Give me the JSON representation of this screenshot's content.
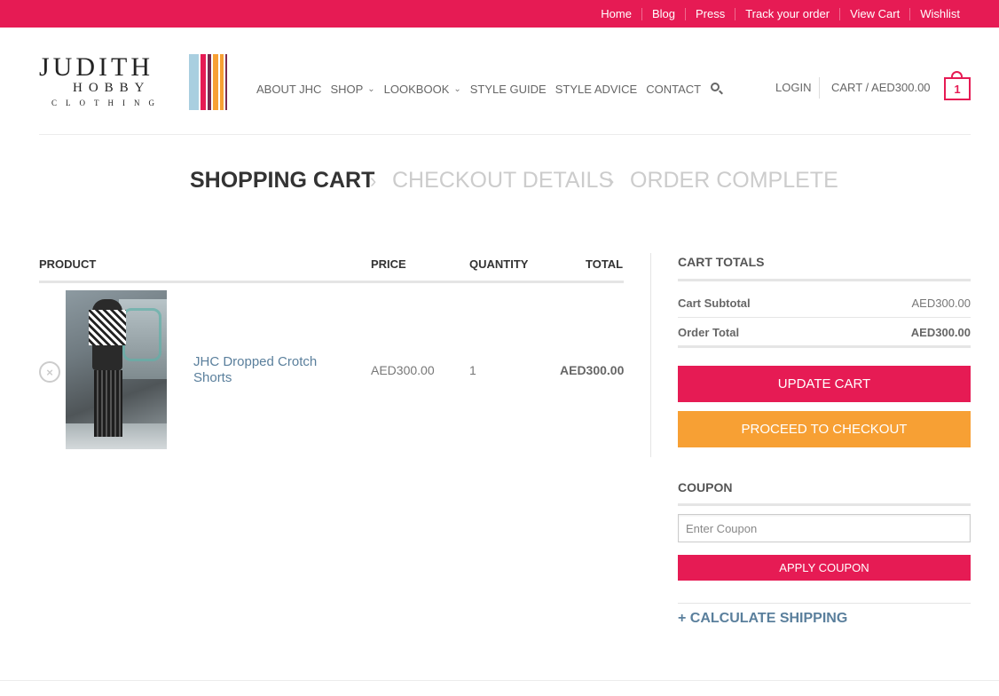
{
  "topbar": {
    "links": [
      "Home",
      "Blog",
      "Press",
      "Track your order",
      "View Cart",
      "Wishlist"
    ],
    "color": "#e61b54"
  },
  "logo": {
    "line1": "JUDITH",
    "line2": "HOBBY",
    "line3": "CLOTHING",
    "stripe_colors": [
      "#a9cfe0",
      "#e61b54",
      "#7a2a4f",
      "#f7a034",
      "#f7a034",
      "#7a2a4f"
    ]
  },
  "nav": {
    "items": [
      {
        "label": "ABOUT JHC",
        "has_dropdown": false
      },
      {
        "label": "SHOP",
        "has_dropdown": true
      },
      {
        "label": "LOOKBOOK",
        "has_dropdown": true
      },
      {
        "label": "STYLE GUIDE",
        "has_dropdown": false
      },
      {
        "label": "STYLE ADVICE",
        "has_dropdown": false
      },
      {
        "label": "CONTACT",
        "has_dropdown": false
      }
    ],
    "search_icon": "search-icon",
    "login": "LOGIN",
    "cart": "CART / AED300.00",
    "cart_count": "1"
  },
  "steps": {
    "active": "SHOPPING CART",
    "step2": "CHECKOUT DETAILS",
    "step3": "ORDER COMPLETE",
    "separator": "›"
  },
  "cart_table": {
    "headers": {
      "product": "PRODUCT",
      "price": "PRICE",
      "quantity": "QUANTITY",
      "total": "TOTAL"
    },
    "rows": [
      {
        "name": "JHC Dropped Crotch Shorts",
        "price": "AED300.00",
        "quantity": "1",
        "total": "AED300.00",
        "remove_icon": "×"
      }
    ]
  },
  "totals": {
    "title": "CART TOTALS",
    "subtotal_label": "Cart Subtotal",
    "subtotal_value": "AED300.00",
    "order_total_label": "Order Total",
    "order_total_value": "AED300.00",
    "update_button": "UPDATE CART",
    "checkout_button": "PROCEED TO CHECKOUT"
  },
  "coupon": {
    "title": "COUPON",
    "placeholder": "Enter Coupon",
    "apply_button": "APPLY COUPON"
  },
  "shipping": {
    "label": "+ CALCULATE SHIPPING"
  },
  "colors": {
    "accent": "#e61b54",
    "checkout": "#f7a034",
    "link": "#5a7f9c"
  }
}
